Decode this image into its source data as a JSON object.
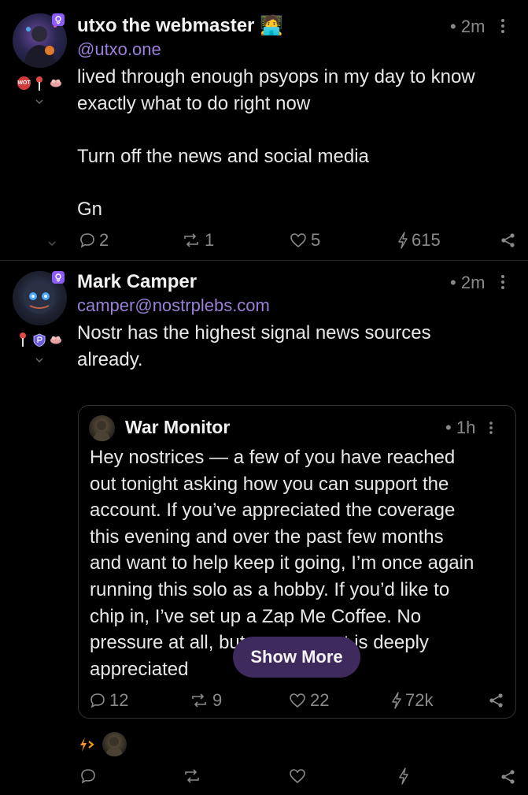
{
  "posts": [
    {
      "author_name": "utxo the webmaster",
      "author_emoji": "🧑‍💻",
      "handle": "@utxo.one",
      "time": "2m",
      "content_lines": [
        "lived through enough psyops in my day to know",
        "exactly what to do right now",
        "",
        "Turn off the news and social media",
        "",
        "Gn"
      ],
      "badge_text": "WOT",
      "replies": "2",
      "reposts": "1",
      "likes": "5",
      "zaps": "615"
    },
    {
      "author_name": "Mark Camper",
      "handle": "camper@nostrplebs.com",
      "time": "2m",
      "content_lines": [
        "Nostr has the highest signal news sources",
        "already."
      ],
      "quote": {
        "author_name": "War Monitor",
        "time": "1h",
        "content_lines": [
          "Hey nostrices — a few of you have reached",
          "out tonight asking how you can support the",
          "account. If you’ve appreciated the coverage",
          "this evening and over the past few months",
          "and want to help keep it going, I’m once again",
          "running this solo as a hobby. If you’d like to",
          "chip in, I’ve set up a Zap Me Coffee. No",
          "pressure at all, but any support is deeply",
          "appreciated"
        ],
        "show_more": "Show More",
        "replies": "12",
        "reposts": "9",
        "likes": "22",
        "zaps": "72k"
      }
    }
  ],
  "colors": {
    "background": "#000000",
    "accent_purple": "#8b5cf6",
    "handle_purple": "#9b7fd9",
    "muted": "#8a8a8a",
    "zap_orange": "#f7931a"
  }
}
